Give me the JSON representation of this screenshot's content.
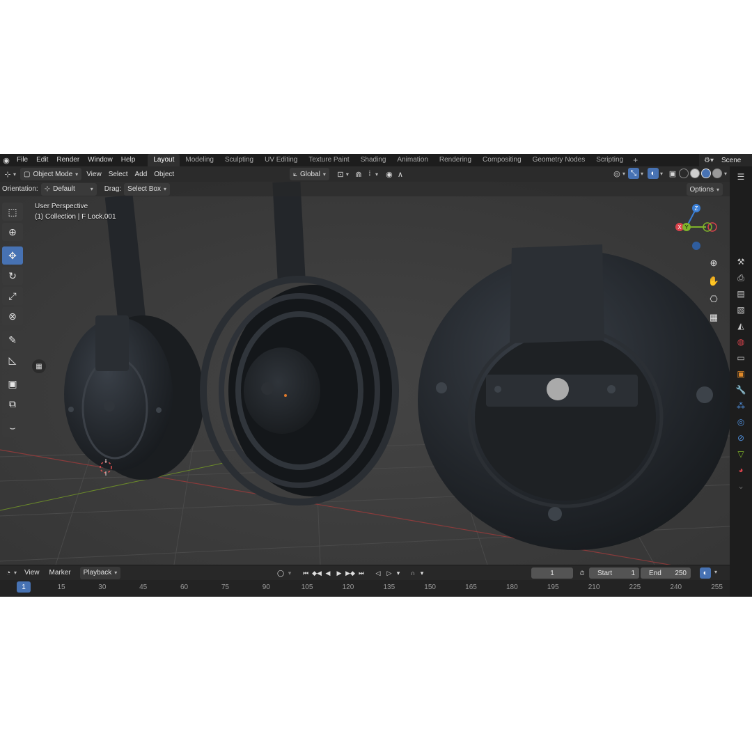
{
  "menubar": {
    "items": [
      "File",
      "Edit",
      "Render",
      "Window",
      "Help"
    ],
    "workspaces": [
      "Layout",
      "Modeling",
      "Sculpting",
      "UV Editing",
      "Texture Paint",
      "Shading",
      "Animation",
      "Rendering",
      "Compositing",
      "Geometry Nodes",
      "Scripting"
    ],
    "active_workspace": "Layout",
    "scene_name": "Scene"
  },
  "viewport_header": {
    "mode": "Object Mode",
    "menus": [
      "View",
      "Select",
      "Add",
      "Object"
    ],
    "transform_orientation": "Global"
  },
  "tool_settings": {
    "orientation_label": "Orientation:",
    "orientation_value": "Default",
    "drag_label": "Drag:",
    "drag_value": "Select Box",
    "options_label": "Options"
  },
  "viewport": {
    "perspective_label": "User Perspective",
    "collection_label": "(1) Collection | F Lock.001",
    "gizmo_axes": [
      "Z",
      "Y",
      "X"
    ]
  },
  "timeline": {
    "menus": [
      "View",
      "Marker",
      "Playback"
    ],
    "current_frame": "1",
    "start_label": "Start",
    "start_value": "1",
    "end_label": "End",
    "end_value": "250",
    "ruler_current": "1",
    "ruler_ticks": [
      "15",
      "30",
      "45",
      "60",
      "75",
      "90",
      "105",
      "120",
      "135",
      "150",
      "165",
      "180",
      "195",
      "210",
      "225",
      "240",
      "255"
    ]
  },
  "colors": {
    "accent": "#4772b3",
    "axis_x": "#d9434c",
    "axis_y": "#7fb32a",
    "axis_z": "#3b7fd6"
  }
}
